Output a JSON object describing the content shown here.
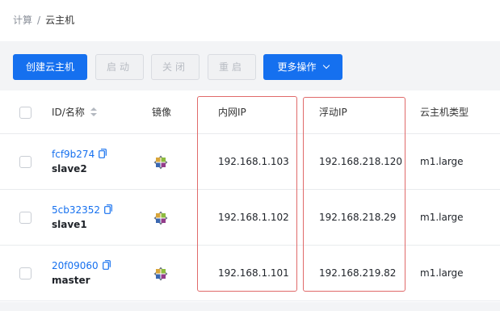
{
  "breadcrumb": {
    "root": "计算",
    "separator": "/",
    "current": "云主机"
  },
  "toolbar": {
    "create_label": "创建云主机",
    "start_label": "启动",
    "close_label": "关闭",
    "reboot_label": "重启",
    "more_label": "更多操作"
  },
  "table": {
    "columns": {
      "id_name": "ID/名称",
      "image": "镜像",
      "inner_ip": "内网IP",
      "floating_ip": "浮动IP",
      "type": "云主机类型"
    },
    "rows": [
      {
        "id": "fcf9b274",
        "name": "slave2",
        "image_icon": "centos-logo-icon",
        "inner_ip": "192.168.1.103",
        "floating_ip": "192.168.218.120",
        "type": "m1.large"
      },
      {
        "id": "5cb32352",
        "name": "slave1",
        "image_icon": "centos-logo-icon",
        "inner_ip": "192.168.1.102",
        "floating_ip": "192.168.218.29",
        "type": "m1.large"
      },
      {
        "id": "20f09060",
        "name": "master",
        "image_icon": "centos-logo-icon",
        "inner_ip": "192.168.1.101",
        "floating_ip": "192.168.219.82",
        "type": "m1.large"
      }
    ]
  },
  "colors": {
    "primary": "#1570ef",
    "highlight": "#e06a6a",
    "link": "#1570ef"
  }
}
